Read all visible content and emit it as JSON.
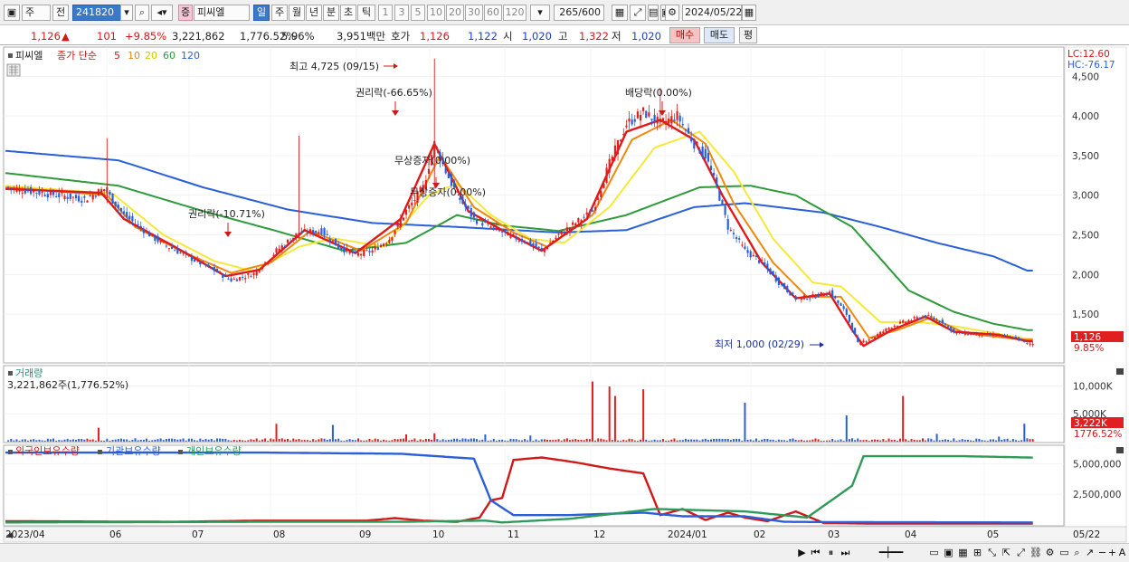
{
  "toolbar": {
    "market": "주",
    "prev_label": "전",
    "code": "241820",
    "badge": "증",
    "stock_name": "피씨엘",
    "periods": [
      "일",
      "주",
      "월",
      "년",
      "분",
      "초",
      "틱"
    ],
    "active_period": "일",
    "intervals": [
      "1",
      "3",
      "5",
      "10",
      "20",
      "30",
      "60",
      "120"
    ],
    "count": "265",
    "count_total": "/600",
    "date": "2024/05/22"
  },
  "quote": {
    "price": "1,126",
    "change_arrow": "▲",
    "change": "101",
    "change_pct": "+9.85%",
    "volume": "3,221,862",
    "volume_pct": "1,776.52%",
    "turnover_pct": "5.96%",
    "amount": "3,951백만",
    "ask_label": "호가",
    "ask": "1,126",
    "bid": "1,122",
    "open_label": "시",
    "open": "1,020",
    "high_label": "고",
    "high": "1,322",
    "low_label": "저",
    "low": "1,020",
    "buy_label": "매수",
    "sell_label": "매도",
    "eval_label": "평"
  },
  "panels": {
    "price_title": "피씨엘",
    "ma_label": "종가 단순",
    "ma_periods": [
      "5",
      "10",
      "20",
      "60",
      "120"
    ],
    "lc": "LC:12.60",
    "hc": "HC:-76.17",
    "current_price_tag": "1,126",
    "current_pct_tag": "9.85%",
    "volume_title": "거래량",
    "volume_value": "3,221,862주(1,776.52%)",
    "volume_tag": "3,222K",
    "volume_pct_tag": "1776.52%",
    "holdings_labels": [
      "외국인보유수량",
      "기관보유수량",
      "개인보유수량"
    ]
  },
  "chart_data": [
    {
      "type": "candlestick",
      "title": "피씨엘",
      "legend": [
        "5",
        "10",
        "20",
        "60",
        "120"
      ],
      "ylim": [
        920,
        4800
      ],
      "y_ticks": [
        1500,
        2000,
        2500,
        3000,
        3500,
        4000,
        4500
      ],
      "y_tick_labels": [
        "1,500",
        "2,000",
        "2,500",
        "3,000",
        "3,500",
        "4,000",
        "4,500"
      ],
      "x_labels": [
        "2023/04",
        "06",
        "07",
        "08",
        "09",
        "10",
        "11",
        "12",
        "2024/01",
        "02",
        "03",
        "04",
        "05",
        "05/22"
      ],
      "annotations": {
        "high": "최고 4,725 (09/15)",
        "low": "최저 1,000 (02/29)",
        "events": [
          "권리락(-10.71%)",
          "권리락(-66.65%)",
          "무상증자(0.00%)",
          "무상증자(0.00%)",
          "배당락(0.00%)"
        ]
      },
      "close_anchors": [
        [
          0,
          3100
        ],
        [
          15,
          3020
        ],
        [
          28,
          2950
        ],
        [
          35,
          3080
        ],
        [
          42,
          2750
        ],
        [
          55,
          2400
        ],
        [
          66,
          2200
        ],
        [
          74,
          2050
        ],
        [
          80,
          1930
        ],
        [
          88,
          2010
        ],
        [
          96,
          2300
        ],
        [
          104,
          2530
        ],
        [
          112,
          2550
        ],
        [
          118,
          2350
        ],
        [
          124,
          2250
        ],
        [
          130,
          2300
        ],
        [
          136,
          2450
        ],
        [
          142,
          2800
        ],
        [
          148,
          3100
        ],
        [
          152,
          3650
        ],
        [
          156,
          3300
        ],
        [
          160,
          3000
        ],
        [
          166,
          2700
        ],
        [
          172,
          2600
        ],
        [
          178,
          2500
        ],
        [
          184,
          2420
        ],
        [
          190,
          2300
        ],
        [
          196,
          2500
        ],
        [
          202,
          2650
        ],
        [
          208,
          2800
        ],
        [
          214,
          3400
        ],
        [
          220,
          3900
        ],
        [
          226,
          4050
        ],
        [
          232,
          3900
        ],
        [
          238,
          4000
        ],
        [
          244,
          3650
        ],
        [
          248,
          3500
        ],
        [
          252,
          3100
        ],
        [
          256,
          2600
        ],
        [
          262,
          2300
        ],
        [
          268,
          2150
        ],
        [
          274,
          1900
        ],
        [
          280,
          1700
        ],
        [
          286,
          1720
        ],
        [
          292,
          1780
        ],
        [
          298,
          1500
        ],
        [
          302,
          1130
        ],
        [
          308,
          1220
        ],
        [
          314,
          1350
        ],
        [
          320,
          1420
        ],
        [
          326,
          1480
        ],
        [
          332,
          1400
        ],
        [
          336,
          1270
        ],
        [
          342,
          1250
        ],
        [
          350,
          1240
        ],
        [
          358,
          1200
        ],
        [
          362,
          1126
        ]
      ],
      "moving_averages": [
        {
          "name": "5",
          "anchors": [
            [
              0,
              3080
            ],
            [
              34,
              3030
            ],
            [
              42,
              2700
            ],
            [
              60,
              2350
            ],
            [
              78,
              1980
            ],
            [
              90,
              2060
            ],
            [
              106,
              2560
            ],
            [
              124,
              2270
            ],
            [
              140,
              2700
            ],
            [
              152,
              3650
            ],
            [
              164,
              2800
            ],
            [
              178,
              2520
            ],
            [
              190,
              2300
            ],
            [
              206,
              2700
            ],
            [
              220,
              3800
            ],
            [
              232,
              3950
            ],
            [
              244,
              3700
            ],
            [
              254,
              3000
            ],
            [
              268,
              2150
            ],
            [
              280,
              1700
            ],
            [
              292,
              1760
            ],
            [
              300,
              1300
            ],
            [
              304,
              1100
            ],
            [
              314,
              1300
            ],
            [
              326,
              1470
            ],
            [
              336,
              1280
            ],
            [
              352,
              1240
            ],
            [
              362,
              1160
            ]
          ]
        },
        {
          "name": "10",
          "anchors": [
            [
              0,
              3100
            ],
            [
              36,
              3000
            ],
            [
              46,
              2600
            ],
            [
              62,
              2300
            ],
            [
              80,
              2020
            ],
            [
              94,
              2150
            ],
            [
              108,
              2550
            ],
            [
              126,
              2300
            ],
            [
              142,
              2650
            ],
            [
              154,
              3500
            ],
            [
              166,
              2850
            ],
            [
              180,
              2530
            ],
            [
              192,
              2350
            ],
            [
              208,
              2750
            ],
            [
              222,
              3700
            ],
            [
              236,
              3950
            ],
            [
              248,
              3650
            ],
            [
              258,
              2900
            ],
            [
              272,
              2150
            ],
            [
              284,
              1720
            ],
            [
              296,
              1720
            ],
            [
              306,
              1200
            ],
            [
              316,
              1300
            ],
            [
              328,
              1460
            ],
            [
              340,
              1260
            ],
            [
              360,
              1180
            ]
          ]
        },
        {
          "name": "20",
          "anchors": [
            [
              0,
              3120
            ],
            [
              38,
              3020
            ],
            [
              56,
              2500
            ],
            [
              74,
              2170
            ],
            [
              88,
              2040
            ],
            [
              104,
              2350
            ],
            [
              116,
              2460
            ],
            [
              134,
              2350
            ],
            [
              150,
              3000
            ],
            [
              160,
              3150
            ],
            [
              172,
              2750
            ],
            [
              186,
              2450
            ],
            [
              198,
              2400
            ],
            [
              214,
              2850
            ],
            [
              230,
              3600
            ],
            [
              246,
              3800
            ],
            [
              258,
              3300
            ],
            [
              272,
              2450
            ],
            [
              286,
              1900
            ],
            [
              296,
              1850
            ],
            [
              310,
              1400
            ],
            [
              324,
              1400
            ],
            [
              336,
              1350
            ],
            [
              362,
              1190
            ]
          ]
        },
        {
          "name": "60",
          "anchors": [
            [
              0,
              3280
            ],
            [
              40,
              3120
            ],
            [
              70,
              2800
            ],
            [
              96,
              2550
            ],
            [
              120,
              2300
            ],
            [
              142,
              2400
            ],
            [
              160,
              2750
            ],
            [
              176,
              2620
            ],
            [
              196,
              2550
            ],
            [
              220,
              2750
            ],
            [
              246,
              3100
            ],
            [
              264,
              3120
            ],
            [
              280,
              3000
            ],
            [
              300,
              2600
            ],
            [
              320,
              1800
            ],
            [
              336,
              1530
            ],
            [
              350,
              1380
            ],
            [
              362,
              1300
            ]
          ]
        },
        {
          "name": "120",
          "anchors": [
            [
              0,
              3560
            ],
            [
              40,
              3440
            ],
            [
              70,
              3100
            ],
            [
              100,
              2820
            ],
            [
              130,
              2650
            ],
            [
              160,
              2600
            ],
            [
              196,
              2530
            ],
            [
              220,
              2560
            ],
            [
              244,
              2850
            ],
            [
              262,
              2900
            ],
            [
              290,
              2780
            ],
            [
              310,
              2600
            ],
            [
              330,
              2400
            ],
            [
              350,
              2230
            ],
            [
              362,
              2050
            ]
          ]
        }
      ]
    },
    {
      "type": "bar",
      "title": "거래량",
      "ylim": [
        0,
        13000000
      ],
      "y_ticks": [
        5000000,
        10000000
      ],
      "y_tick_labels": [
        "5,000K",
        "10,000K"
      ],
      "spikes": [
        [
          33,
          2500000
        ],
        [
          96,
          3200000
        ],
        [
          116,
          3000000
        ],
        [
          142,
          1300000
        ],
        [
          152,
          1500000
        ],
        [
          170,
          1300000
        ],
        [
          186,
          1100000
        ],
        [
          208,
          10800000
        ],
        [
          214,
          9900000
        ],
        [
          216,
          8200000
        ],
        [
          226,
          9400000
        ],
        [
          262,
          7000000
        ],
        [
          298,
          4700000
        ],
        [
          318,
          8200000
        ],
        [
          330,
          1400000
        ],
        [
          352,
          900000
        ],
        [
          361,
          3222000
        ]
      ]
    },
    {
      "type": "line",
      "title": "보유수량",
      "legend": [
        "외국인보유수량",
        "기관보유수량",
        "개인보유수량"
      ],
      "ylim": [
        0,
        6200000
      ],
      "y_ticks": [
        2500000,
        5000000
      ],
      "y_tick_labels": [
        "2,500,000",
        "5,000,000"
      ],
      "series": [
        {
          "name": "외국인보유수량",
          "color": "#d01818",
          "anchors": [
            [
              0,
              300000
            ],
            [
              60,
              250000
            ],
            [
              90,
              350000
            ],
            [
              128,
              350000
            ],
            [
              138,
              550000
            ],
            [
              148,
              350000
            ],
            [
              160,
              250000
            ],
            [
              168,
              600000
            ],
            [
              172,
              2000000
            ],
            [
              176,
              2200000
            ],
            [
              180,
              5300000
            ],
            [
              190,
              5500000
            ],
            [
              202,
              5100000
            ],
            [
              214,
              4600000
            ],
            [
              226,
              4200000
            ],
            [
              232,
              800000
            ],
            [
              240,
              1300000
            ],
            [
              248,
              400000
            ],
            [
              256,
              1000000
            ],
            [
              262,
              600000
            ],
            [
              270,
              300000
            ],
            [
              280,
              1100000
            ],
            [
              290,
              150000
            ],
            [
              310,
              100000
            ],
            [
              362,
              100000
            ]
          ]
        },
        {
          "name": "기관보유수량",
          "color": "#2a5fd8",
          "anchors": [
            [
              0,
              5900000
            ],
            [
              90,
              5900000
            ],
            [
              140,
              5800000
            ],
            [
              166,
              5400000
            ],
            [
              172,
              2000000
            ],
            [
              180,
              800000
            ],
            [
              200,
              800000
            ],
            [
              226,
              1000000
            ],
            [
              240,
              700000
            ],
            [
              262,
              700000
            ],
            [
              276,
              250000
            ],
            [
              300,
              220000
            ],
            [
              362,
              200000
            ]
          ]
        },
        {
          "name": "개인보유수량",
          "color": "#2e9a5a",
          "anchors": [
            [
              0,
              200000
            ],
            [
              90,
              250000
            ],
            [
              140,
              250000
            ],
            [
              170,
              350000
            ],
            [
              176,
              200000
            ],
            [
              200,
              500000
            ],
            [
              230,
              1300000
            ],
            [
              262,
              1100000
            ],
            [
              284,
              600000
            ],
            [
              300,
              3200000
            ],
            [
              304,
              5600000
            ],
            [
              340,
              5600000
            ],
            [
              362,
              5500000
            ],
            [
              374,
              5400000
            ],
            [
              382,
              5600000
            ],
            [
              395,
              5500000
            ],
            [
              450,
              5550000
            ]
          ]
        }
      ]
    }
  ]
}
